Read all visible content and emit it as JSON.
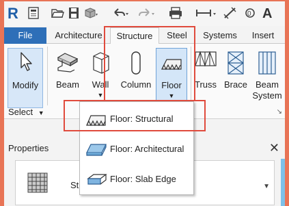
{
  "quick_access": {
    "app_logo": "R",
    "text_button": "A",
    "icons": [
      "revit-logo-icon",
      "new-file-icon",
      "open-folder-icon",
      "save-icon",
      "sync-icon",
      "undo-icon",
      "redo-icon",
      "print-icon",
      "measure-icon",
      "dimension-icon",
      "tag-icon",
      "text-icon"
    ]
  },
  "tabs": [
    {
      "label": "File"
    },
    {
      "label": "Architecture"
    },
    {
      "label": "Structure"
    },
    {
      "label": "Steel"
    },
    {
      "label": "Systems"
    },
    {
      "label": "Insert"
    }
  ],
  "ribbon": {
    "modify": "Modify",
    "beam": "Beam",
    "wall": "Wall",
    "column": "Column",
    "floor": "Floor",
    "truss": "Truss",
    "brace": "Brace",
    "beam_system_1": "Beam",
    "beam_system_2": "System",
    "select": "Select"
  },
  "floor_menu": {
    "items": [
      {
        "label": "Floor: Structural"
      },
      {
        "label": "Floor: Architectural"
      },
      {
        "label": "Floor: Slab Edge"
      }
    ]
  },
  "properties": {
    "title": "Properties",
    "close": "✕",
    "type_text": "Str"
  },
  "colors": {
    "outer_background": "#e87456",
    "file_tab": "#2e6fb8",
    "highlight": "#e04a3c",
    "selected_button": "#d4e6f8"
  }
}
